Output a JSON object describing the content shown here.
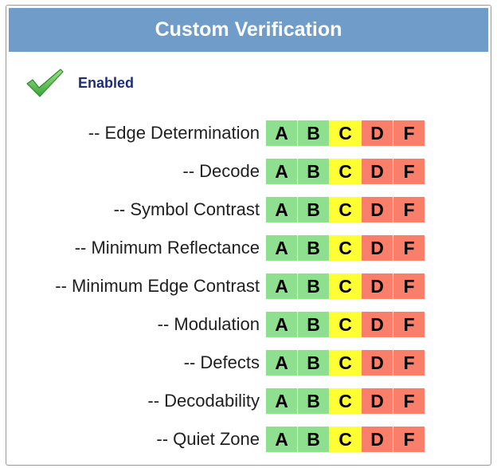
{
  "panel": {
    "title": "Custom Verification"
  },
  "status": {
    "icon": "checkmark-icon",
    "label": "Enabled"
  },
  "grade_colors": {
    "A": "#8ee08e",
    "B": "#8ee08e",
    "C": "#ffff33",
    "D": "#fa7f6a",
    "F": "#fa7f6a"
  },
  "parameters": [
    {
      "label": "-- Edge Determination",
      "grades": [
        "A",
        "B",
        "C",
        "D",
        "F"
      ]
    },
    {
      "label": "-- Decode",
      "grades": [
        "A",
        "B",
        "C",
        "D",
        "F"
      ]
    },
    {
      "label": "-- Symbol Contrast",
      "grades": [
        "A",
        "B",
        "C",
        "D",
        "F"
      ]
    },
    {
      "label": "-- Minimum Reflectance",
      "grades": [
        "A",
        "B",
        "C",
        "D",
        "F"
      ]
    },
    {
      "label": "-- Minimum Edge Contrast",
      "grades": [
        "A",
        "B",
        "C",
        "D",
        "F"
      ]
    },
    {
      "label": "-- Modulation",
      "grades": [
        "A",
        "B",
        "C",
        "D",
        "F"
      ]
    },
    {
      "label": "-- Defects",
      "grades": [
        "A",
        "B",
        "C",
        "D",
        "F"
      ]
    },
    {
      "label": "-- Decodability",
      "grades": [
        "A",
        "B",
        "C",
        "D",
        "F"
      ]
    },
    {
      "label": "-- Quiet Zone",
      "grades": [
        "A",
        "B",
        "C",
        "D",
        "F"
      ]
    }
  ]
}
